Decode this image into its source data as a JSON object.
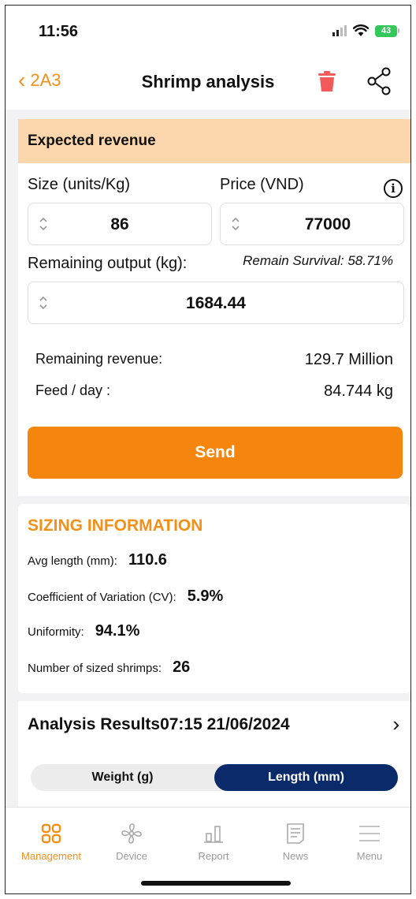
{
  "status": {
    "time": "11:56",
    "battery": "43"
  },
  "nav": {
    "back_label": "2A3",
    "title": "Shrimp analysis"
  },
  "revenue": {
    "header": "Expected revenue",
    "size_label": "Size (units/Kg)",
    "size_value": "86",
    "price_label": "Price (VND)",
    "price_value": "77000",
    "remaining_label": "Remaining output (kg):",
    "survival": "Remain Survival: 58.71%",
    "remaining_value": "1684.44",
    "rev_label": "Remaining revenue:",
    "rev_value": "129.7 Million",
    "feed_label": "Feed / day :",
    "feed_value": "84.744 kg",
    "send_label": "Send"
  },
  "sizing": {
    "title": "SIZING INFORMATION",
    "avg_label": "Avg length (mm):",
    "avg_value": "110.6",
    "cv_label": "Coefficient of Variation (CV):",
    "cv_value": "5.9%",
    "uni_label": "Uniformity:",
    "uni_value": "94.1%",
    "num_label": "Number of sized shrimps:",
    "num_value": "26"
  },
  "results": {
    "title": "Analysis Results07:15 21/06/2024",
    "seg_weight": "Weight (g)",
    "seg_length": "Length (mm)",
    "active": "length"
  },
  "tabs": [
    {
      "label": "Management",
      "icon": "grid-icon"
    },
    {
      "label": "Device",
      "icon": "fan-icon"
    },
    {
      "label": "Report",
      "icon": "bar-chart-icon"
    },
    {
      "label": "News",
      "icon": "news-icon"
    },
    {
      "label": "Menu",
      "icon": "menu-icon"
    }
  ],
  "colors": {
    "accent": "#f39019",
    "send": "#f6850d",
    "header_bg": "#fbd6ad",
    "segment_active": "#0a2a6a"
  }
}
